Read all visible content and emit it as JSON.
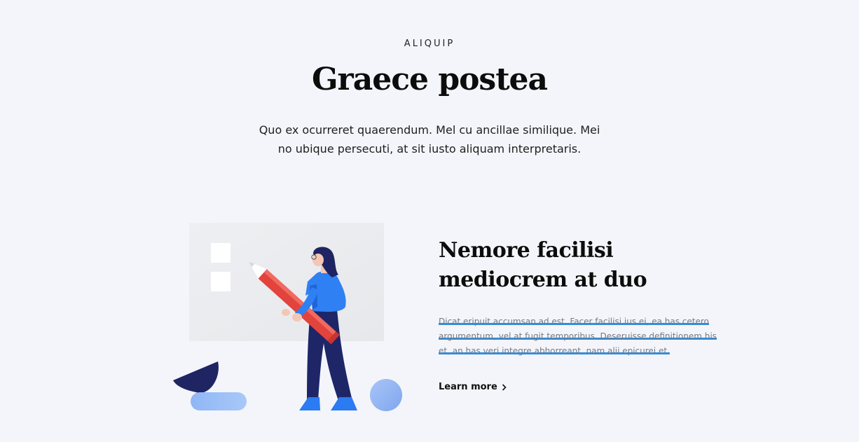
{
  "section": {
    "eyebrow": "ALIQUIP",
    "title": "Graece postea",
    "lead": "Quo ex ocurreret quaerendum. Mel cu ancillae similique. Mei no ubique persecuti, at sit iusto aliquam interpretaris."
  },
  "feature": {
    "title": "Nemore facilisi mediocrem at duo",
    "body": "Dicat eripuit accumsan ad est. Facer facilisi ius ei, ea has cetero argumentum, vel at fugit temporibus. Deseruisse definitionem his et, an has veri integre abhorreant, nam alii epicurei et.",
    "link_label": "Learn more",
    "link_icon": "chevron-right-icon",
    "highlight_color": "#2d8fe3"
  },
  "illustration": {
    "subject": "person-holding-pencil-illustration"
  }
}
